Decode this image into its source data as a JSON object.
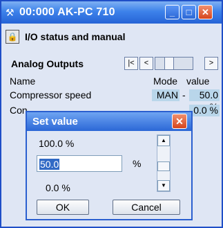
{
  "window": {
    "title": "00:000 AK-PC 710",
    "app_icon": "wrench-icon",
    "minimize_glyph": "_",
    "maximize_glyph": "□",
    "close_glyph": "✕"
  },
  "section": {
    "title": "I/O status and manual",
    "lock_icon": "lock-icon",
    "lock_glyph": "🔒"
  },
  "analog_outputs": {
    "title": "Analog Outputs",
    "nav": {
      "first_glyph": "|<",
      "prev_glyph": "<",
      "next_glyph": ">"
    },
    "columns": {
      "name": "Name",
      "mode": "Mode",
      "value": "value"
    },
    "rows": [
      {
        "name": "Compressor speed",
        "mode": "MAN",
        "dash": "-",
        "value": "50.0 %"
      },
      {
        "name": "Con",
        "mode": "",
        "dash": "",
        "value": "0.0 %"
      }
    ]
  },
  "dialog": {
    "title": "Set value",
    "close_glyph": "✕",
    "max_label": "100.0 %",
    "input_value": "50.0",
    "unit": "%",
    "min_label": "0.0 %",
    "slider_up_glyph": "▲",
    "slider_down_glyph": "▼",
    "ok_label": "OK",
    "cancel_label": "Cancel"
  },
  "colors": {
    "titlebar": "#2663d6",
    "window_bg": "#dfe6f4",
    "value_cell": "#b9d6ea",
    "close_button": "#d6451d"
  }
}
